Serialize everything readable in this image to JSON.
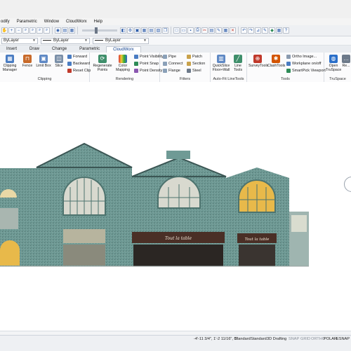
{
  "menubar": {
    "items": [
      "odify",
      "Parametric",
      "Window",
      "CloudWorx",
      "Help"
    ]
  },
  "layerbar": {
    "layer_value": "ByLayer",
    "linetype_value": "ByLayer",
    "lineweight_value": "ByLayer"
  },
  "ribbon_tabs": [
    "Insert",
    "Draw",
    "Change",
    "Parametric",
    "CloudWorx"
  ],
  "ribbon": {
    "clipping": {
      "label": "Clipping",
      "buttons": [
        "Clipping Manager",
        "Fence",
        "Limit Box",
        "Slice"
      ],
      "small": [
        "Forward",
        "Backward",
        "Reset Clip"
      ]
    },
    "rendering": {
      "label": "Rendering",
      "buttons": [
        "Regenerate Points",
        "Color Mapping"
      ],
      "small": [
        "Point Visibility",
        "Point Snap",
        "Point Density"
      ]
    },
    "fitters": {
      "label": "Fitters",
      "small": [
        "Pipe",
        "Connect",
        "Flange",
        "Patch",
        "Section",
        "Steel"
      ]
    },
    "autofit": {
      "label": "Auto-Fit LineTools",
      "buttons": [
        "QuickSlice Floor+Wall",
        "Line Tools"
      ]
    },
    "tools": {
      "label": "Tools",
      "buttons": [
        "SurveyTools",
        "ClashTools"
      ],
      "small": [
        "Ortho Image...",
        "Workplane on/off",
        "SmartPick Viewport"
      ]
    },
    "truspace": {
      "label": "TruSpace",
      "buttons": [
        "Open TruSpace",
        "Re..."
      ]
    }
  },
  "building": {
    "signs": [
      "Tout la table",
      "Tout la table"
    ],
    "palette": {
      "wall": "#6f9a95",
      "wall_dark": "#4d736e",
      "roof_shadow": "#3b5654",
      "window_light": "#e9d8a6",
      "window_glow": "#e8b94a",
      "awning": "#4a2f26",
      "storefront": "#2b2623"
    }
  },
  "status": {
    "coordinates": "-4'-11 3/4\", 1'-2 11/16\", 0\"",
    "items": [
      "Standard",
      "Standard",
      "3D Drafting",
      "SNAP",
      "GRID",
      "ORTHO",
      "POLAR",
      "ESNAP"
    ]
  }
}
